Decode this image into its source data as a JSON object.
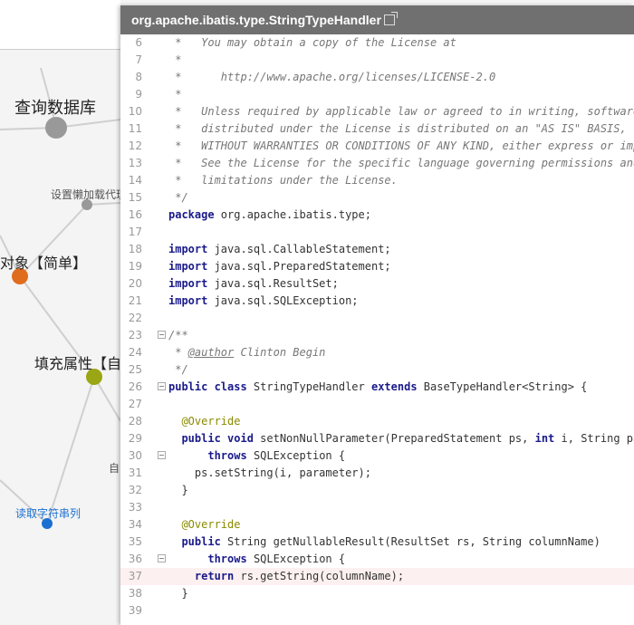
{
  "panel": {
    "title": "org.apache.ibatis.type.StringTypeHandler"
  },
  "mindmap": {
    "nodes": [
      {
        "label": "查询数据库"
      },
      {
        "label": "设置懒加载代理"
      },
      {
        "label": "对象【简单】"
      },
      {
        "label": "填充属性【自"
      },
      {
        "label": "自"
      },
      {
        "label": "读取字符串列"
      }
    ],
    "colors": {
      "big": "#999999",
      "small": "#999999",
      "orange": "#e06c1e",
      "green": "#9aa613",
      "blue": "#1a6fd1"
    }
  },
  "code": {
    "lines": [
      {
        "n": "6",
        "tokens": [
          {
            "t": " *   You may obtain a copy of the License at",
            "c": "c"
          }
        ]
      },
      {
        "n": "7",
        "tokens": [
          {
            "t": " *",
            "c": "c"
          }
        ]
      },
      {
        "n": "8",
        "tokens": [
          {
            "t": " *      http://www.apache.org/licenses/LICENSE-2.0",
            "c": "c"
          }
        ]
      },
      {
        "n": "9",
        "tokens": [
          {
            "t": " *",
            "c": "c"
          }
        ]
      },
      {
        "n": "10",
        "tokens": [
          {
            "t": " *   Unless required by applicable law or agreed to in writing, software",
            "c": "c"
          }
        ]
      },
      {
        "n": "11",
        "tokens": [
          {
            "t": " *   distributed under the License is distributed on an \"AS IS\" BASIS,",
            "c": "c"
          }
        ]
      },
      {
        "n": "12",
        "tokens": [
          {
            "t": " *   WITHOUT WARRANTIES OR CONDITIONS OF ANY KIND, either express or impl",
            "c": "c"
          }
        ]
      },
      {
        "n": "13",
        "tokens": [
          {
            "t": " *   See the License for the specific language governing permissions and",
            "c": "c"
          }
        ]
      },
      {
        "n": "14",
        "tokens": [
          {
            "t": " *   limitations under the License.",
            "c": "c"
          }
        ]
      },
      {
        "n": "15",
        "tokens": [
          {
            "t": " */",
            "c": "c"
          }
        ]
      },
      {
        "n": "16",
        "tokens": [
          {
            "t": "package",
            "c": "k"
          },
          {
            "t": " org.apache.ibatis.type;",
            "c": ""
          }
        ]
      },
      {
        "n": "17",
        "tokens": []
      },
      {
        "n": "18",
        "tokens": [
          {
            "t": "import",
            "c": "k"
          },
          {
            "t": " java.sql.CallableStatement;",
            "c": ""
          }
        ]
      },
      {
        "n": "19",
        "tokens": [
          {
            "t": "import",
            "c": "k"
          },
          {
            "t": " java.sql.PreparedStatement;",
            "c": ""
          }
        ]
      },
      {
        "n": "20",
        "tokens": [
          {
            "t": "import",
            "c": "k"
          },
          {
            "t": " java.sql.ResultSet;",
            "c": ""
          }
        ]
      },
      {
        "n": "21",
        "tokens": [
          {
            "t": "import",
            "c": "k"
          },
          {
            "t": " java.sql.SQLException;",
            "c": ""
          }
        ]
      },
      {
        "n": "22",
        "tokens": []
      },
      {
        "n": "23",
        "fold": true,
        "tokens": [
          {
            "t": "/**",
            "c": "c"
          }
        ]
      },
      {
        "n": "24",
        "tokens": [
          {
            "t": " * ",
            "c": "c"
          },
          {
            "t": "@author",
            "c": "d"
          },
          {
            "t": " Clinton Begin",
            "c": "c"
          }
        ]
      },
      {
        "n": "25",
        "tokens": [
          {
            "t": " */",
            "c": "c"
          }
        ]
      },
      {
        "n": "26",
        "fold": true,
        "tokens": [
          {
            "t": "public class",
            "c": "k"
          },
          {
            "t": " StringTypeHandler ",
            "c": ""
          },
          {
            "t": "extends",
            "c": "k"
          },
          {
            "t": " BaseTypeHandler<String> {",
            "c": ""
          }
        ]
      },
      {
        "n": "27",
        "tokens": []
      },
      {
        "n": "28",
        "tokens": [
          {
            "t": "  @Override",
            "c": "a"
          }
        ]
      },
      {
        "n": "29",
        "tokens": [
          {
            "t": "  ",
            "c": ""
          },
          {
            "t": "public void",
            "c": "k"
          },
          {
            "t": " setNonNullParameter(PreparedStatement ps, ",
            "c": ""
          },
          {
            "t": "int",
            "c": "k"
          },
          {
            "t": " i, String pa",
            "c": ""
          }
        ]
      },
      {
        "n": "30",
        "fold": true,
        "tokens": [
          {
            "t": "      ",
            "c": ""
          },
          {
            "t": "throws",
            "c": "k"
          },
          {
            "t": " SQLException {",
            "c": ""
          }
        ]
      },
      {
        "n": "31",
        "tokens": [
          {
            "t": "    ps.setString(i, parameter);",
            "c": ""
          }
        ]
      },
      {
        "n": "32",
        "tokens": [
          {
            "t": "  }",
            "c": ""
          }
        ]
      },
      {
        "n": "33",
        "tokens": []
      },
      {
        "n": "34",
        "tokens": [
          {
            "t": "  @Override",
            "c": "a"
          }
        ]
      },
      {
        "n": "35",
        "tokens": [
          {
            "t": "  ",
            "c": ""
          },
          {
            "t": "public",
            "c": "k"
          },
          {
            "t": " String getNullableResult(ResultSet rs, String columnName)",
            "c": ""
          }
        ]
      },
      {
        "n": "36",
        "fold": true,
        "tokens": [
          {
            "t": "      ",
            "c": ""
          },
          {
            "t": "throws",
            "c": "k"
          },
          {
            "t": " SQLException {",
            "c": ""
          }
        ]
      },
      {
        "n": "37",
        "highlight": true,
        "tokens": [
          {
            "t": "    ",
            "c": ""
          },
          {
            "t": "return",
            "c": "k"
          },
          {
            "t": " rs.getString(columnName);",
            "c": ""
          }
        ]
      },
      {
        "n": "38",
        "tokens": [
          {
            "t": "  }",
            "c": ""
          }
        ]
      },
      {
        "n": "39",
        "tokens": []
      }
    ]
  }
}
